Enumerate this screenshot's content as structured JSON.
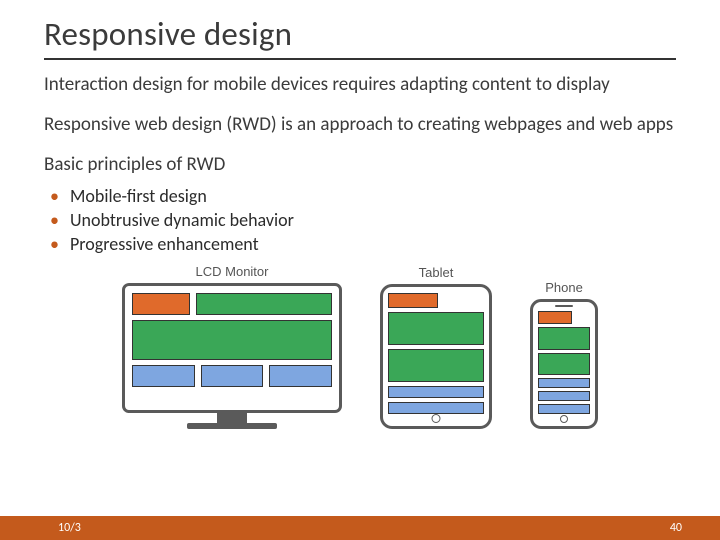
{
  "title": "Responsive design",
  "paragraphs": {
    "p1": "Interaction design for mobile devices requires adapting content to display",
    "p2": "Responsive web design (RWD) is an approach to creating webpages and web apps",
    "p3": "Basic principles of RWD"
  },
  "bullets": {
    "b1": "Mobile-first design",
    "b2": "Unobtrusive dynamic behavior",
    "b3": "Progressive enhancement"
  },
  "devices": {
    "monitor_label": "LCD Monitor",
    "tablet_label": "Tablet",
    "phone_label": "Phone"
  },
  "footer": {
    "date_partial": "10/3",
    "page_number": "40"
  },
  "colors": {
    "accent": "#c45a1c",
    "device_border": "#5a5a5a",
    "block_orange": "#e06a2b",
    "block_green": "#3aa757",
    "block_blue": "#7ea6e0"
  }
}
